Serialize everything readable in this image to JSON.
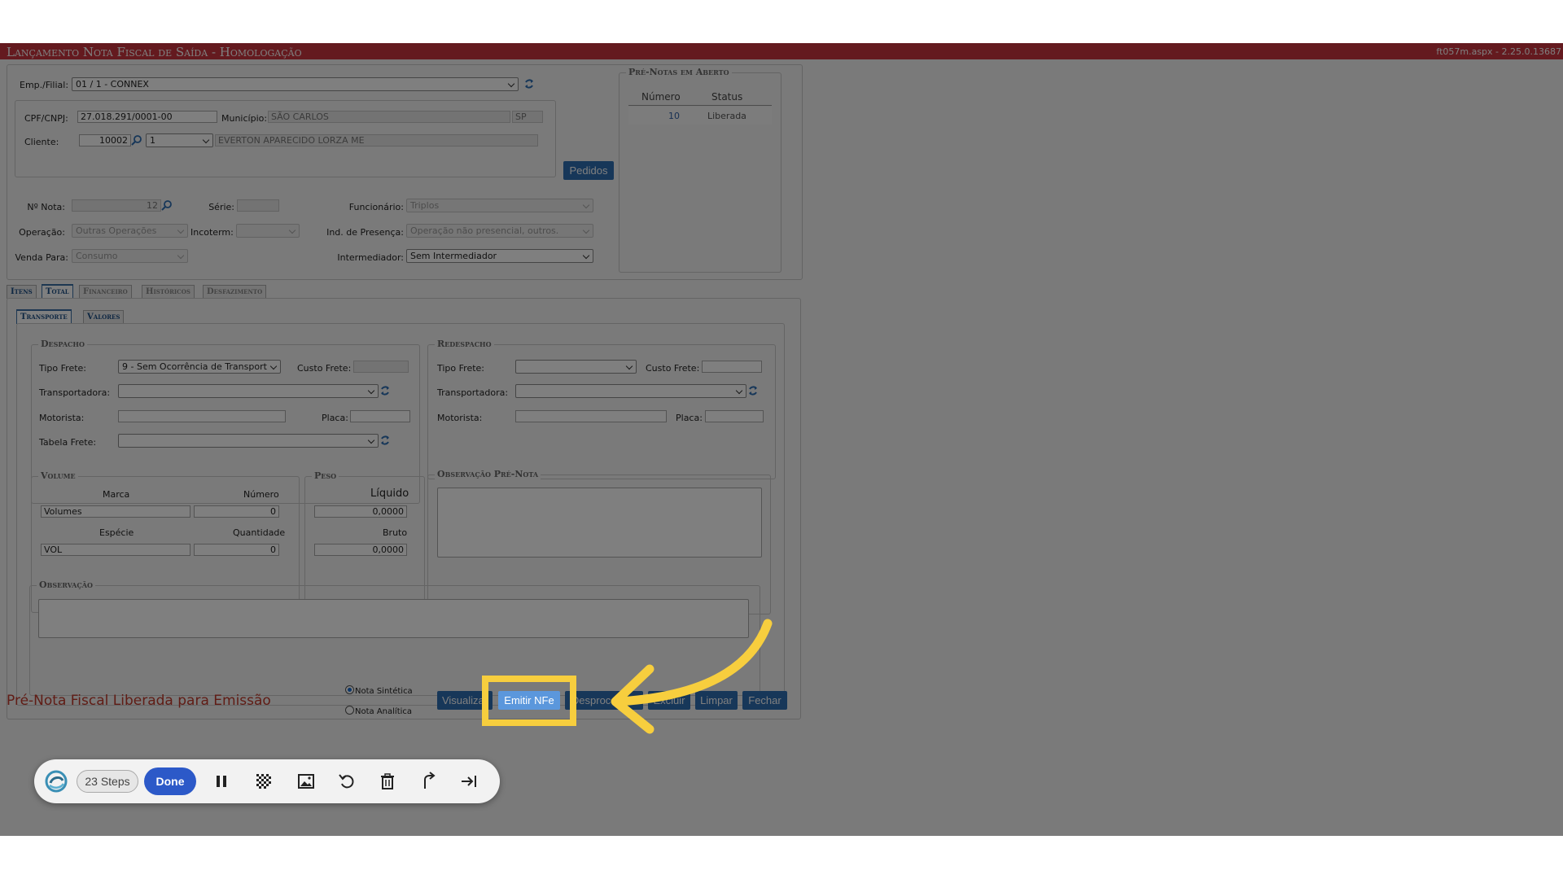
{
  "window": {
    "title": "Lançamento Nota Fiscal de Saída  - Homologação",
    "version": "ft057m.aspx - 2.25.0.13687"
  },
  "header": {
    "emp_filial_label": "Emp./Filial:",
    "emp_filial_value": "01 / 1 - CONNEX",
    "cpf_label": "CPF/CNPJ:",
    "cpf_value": "27.018.291/0001-00",
    "municipio_label": "Município:",
    "municipio_value": "SÃO CARLOS",
    "uf_value": "SP",
    "cliente_label": "Cliente:",
    "cliente_code": "10002",
    "cliente_loja": "1",
    "cliente_name": "EVERTON APARECIDO LORZA ME",
    "pedidos_button": "Pedidos",
    "nota_label": "Nº Nota:",
    "nota_value": "12",
    "serie_label": "Série:",
    "serie_value": "",
    "funcionario_label": "Funcionário:",
    "funcionario_value": "Triplos",
    "operacao_label": "Operação:",
    "operacao_value": "Outras Operações",
    "incoterm_label": "Incoterm:",
    "incoterm_value": "",
    "ind_presenca_label": "Ind. de Presença:",
    "ind_presenca_value": "Operação não presencial, outros.",
    "venda_para_label": "Venda Para:",
    "venda_para_value": "Consumo",
    "intermediador_label": "Intermediador:",
    "intermediador_value": "Sem Intermediador"
  },
  "pre_notas": {
    "title": "Pré-Notas em Aberto",
    "col_numero": "Número",
    "col_status": "Status",
    "rows": [
      {
        "numero": "10",
        "status": "Liberada"
      }
    ]
  },
  "tabs": [
    {
      "label": "Itens"
    },
    {
      "label": "Total"
    },
    {
      "label": "Financeiro"
    },
    {
      "label": "Históricos"
    },
    {
      "label": "Desfazimento"
    }
  ],
  "subtabs": [
    {
      "label": "Transporte"
    },
    {
      "label": "Valores"
    }
  ],
  "despacho": {
    "title": "Despacho",
    "tipo_frete_label": "Tipo Frete:",
    "tipo_frete_value": "9 - Sem Ocorrência de Transport",
    "custo_frete_label": "Custo Frete:",
    "custo_frete_value": "",
    "transportadora_label": "Transportadora:",
    "transportadora_value": "",
    "motorista_label": "Motorista:",
    "motorista_value": "",
    "placa_label": "Placa:",
    "placa_value": "",
    "tabela_frete_label": "Tabela Frete:",
    "tabela_frete_value": ""
  },
  "redespacho": {
    "title": "Redespacho",
    "tipo_frete_label": "Tipo Frete:",
    "tipo_frete_value": "",
    "custo_frete_label": "Custo Frete:",
    "custo_frete_value": "",
    "transportadora_label": "Transportadora:",
    "transportadora_value": "",
    "motorista_label": "Motorista:",
    "motorista_value": "",
    "placa_label": "Placa:",
    "placa_value": ""
  },
  "volume": {
    "title": "Volume",
    "marca_label": "Marca",
    "numero_label": "Número",
    "marca_value": "Volumes",
    "numero_value": "0",
    "especie_label": "Espécie",
    "quantidade_label": "Quantidade",
    "especie_value": "VOL",
    "quantidade_value": "0"
  },
  "peso": {
    "title": "Peso",
    "liquido_label": "Líquido",
    "liquido_value": "0,0000",
    "bruto_label": "Bruto",
    "bruto_value": "0,0000"
  },
  "obs_pre_nota": {
    "title": "Observação Pré-Nota"
  },
  "observacao": {
    "title": "Observação"
  },
  "footer": {
    "status_message": "Pré-Nota Fiscal Liberada para Emissão",
    "radio_sintetica": "Nota Sintética",
    "radio_analitica": "Nota Analítica",
    "btn_visualizar": "Visualizar",
    "btn_emitir": "Emitir NFe",
    "btn_desprocessar": "Desprocessar",
    "btn_excluir": "Excluir",
    "btn_limpar": "Limpar",
    "btn_fechar": "Fechar"
  },
  "recorder": {
    "steps_label": "23 Steps",
    "done_label": "Done",
    "icons": [
      "logo-icon",
      "pause-icon",
      "blur-icon",
      "image-icon",
      "undo-icon",
      "trash-icon",
      "share-icon",
      "skip-icon"
    ]
  },
  "colors": {
    "title_bar": "#c9353f",
    "button_blue": "#2f6fb3",
    "highlight_yellow": "#f7ce3e",
    "status_red": "#c0392b"
  }
}
